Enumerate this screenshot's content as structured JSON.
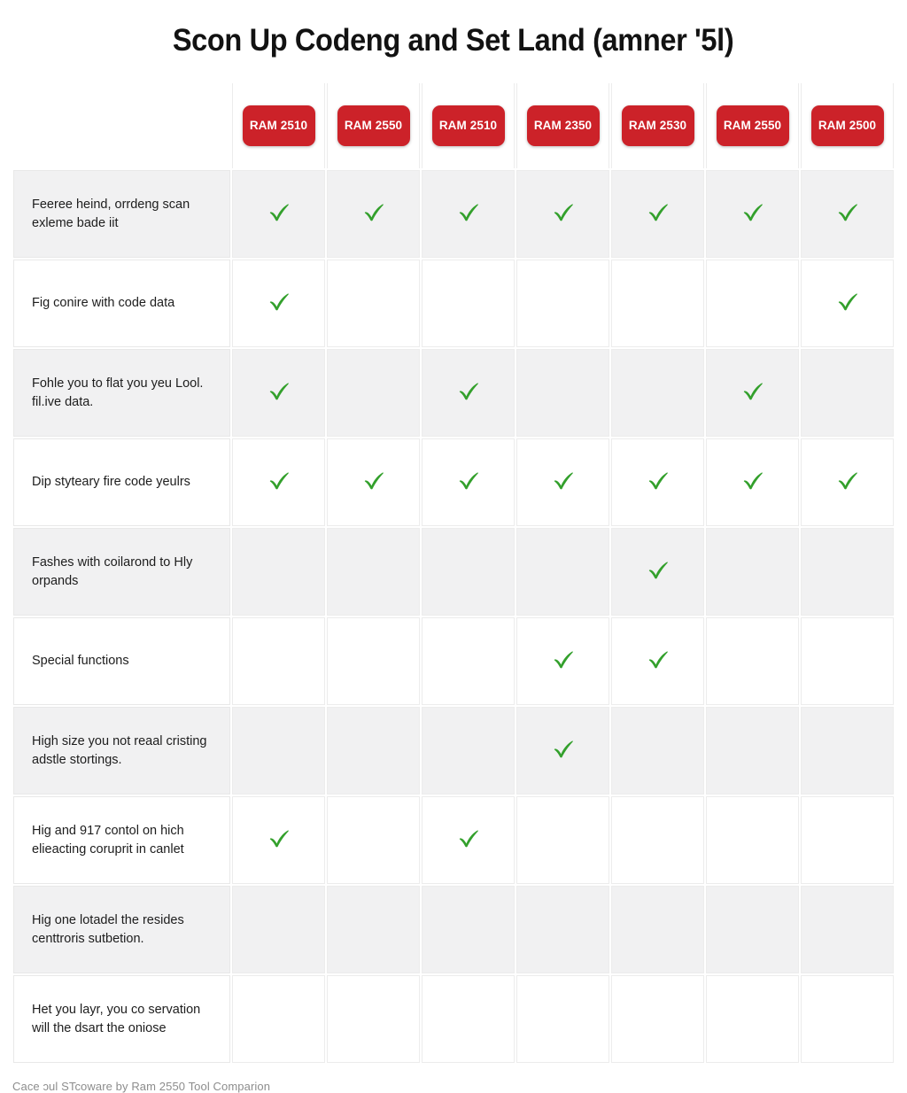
{
  "page": {
    "title": "Scon Up Codeng and Set Land (amner '5l)",
    "footer_caption": "Cace ɔul STcoware by Ram 2550 Tool Comparion"
  },
  "colors": {
    "badge_background": "#cc2229",
    "badge_text": "#ffffff",
    "check_mark": "#33a02c",
    "row_stripe": "#f1f1f2",
    "row_plain": "#ffffff",
    "grid_line": "#ececec",
    "title_text": "#121212",
    "label_text": "#1d1d1d",
    "footer_text": "#8d8d8d"
  },
  "icons": {
    "check": "check-mark-icon"
  },
  "matrix": {
    "columns": [
      {
        "label": "RAM 2510"
      },
      {
        "label": "RAM 2550"
      },
      {
        "label": "RAM 2510"
      },
      {
        "label": "RAM 2350"
      },
      {
        "label": "RAM 2530"
      },
      {
        "label": "RAM 2550"
      },
      {
        "label": "RAM 2500"
      }
    ],
    "rows": [
      {
        "label": "Feeree heind, orrdeng scan exleme bade iit",
        "marks": [
          true,
          true,
          true,
          true,
          true,
          true,
          true
        ]
      },
      {
        "label": "Fig conire with code data",
        "marks": [
          true,
          false,
          false,
          false,
          false,
          false,
          true
        ]
      },
      {
        "label": "Fohle you to flat you yeu Lool. fil.ive data.",
        "marks": [
          true,
          false,
          true,
          false,
          false,
          true,
          false
        ]
      },
      {
        "label": "Dip styteary fire code yeulrs",
        "marks": [
          true,
          true,
          true,
          true,
          true,
          true,
          true
        ]
      },
      {
        "label": "Fashes with coilarond to Hly orpands",
        "marks": [
          false,
          false,
          false,
          false,
          true,
          false,
          false
        ]
      },
      {
        "label": "Special functions",
        "marks": [
          false,
          false,
          false,
          true,
          true,
          false,
          false
        ]
      },
      {
        "label": "High size you not reaal cristing adstle stortings.",
        "marks": [
          false,
          false,
          false,
          true,
          false,
          false,
          false
        ]
      },
      {
        "label": "Hig and 917 contol on hich elieacting coruprit in canlet",
        "marks": [
          true,
          false,
          true,
          false,
          false,
          false,
          false
        ]
      },
      {
        "label": "Hig one lotadel the resides centtroris sutbetion.",
        "marks": [
          false,
          false,
          false,
          false,
          false,
          false,
          false
        ]
      },
      {
        "label": "Het you layr, you co servation will the dsart the oniose",
        "marks": [
          false,
          false,
          false,
          false,
          false,
          false,
          false
        ]
      }
    ]
  }
}
